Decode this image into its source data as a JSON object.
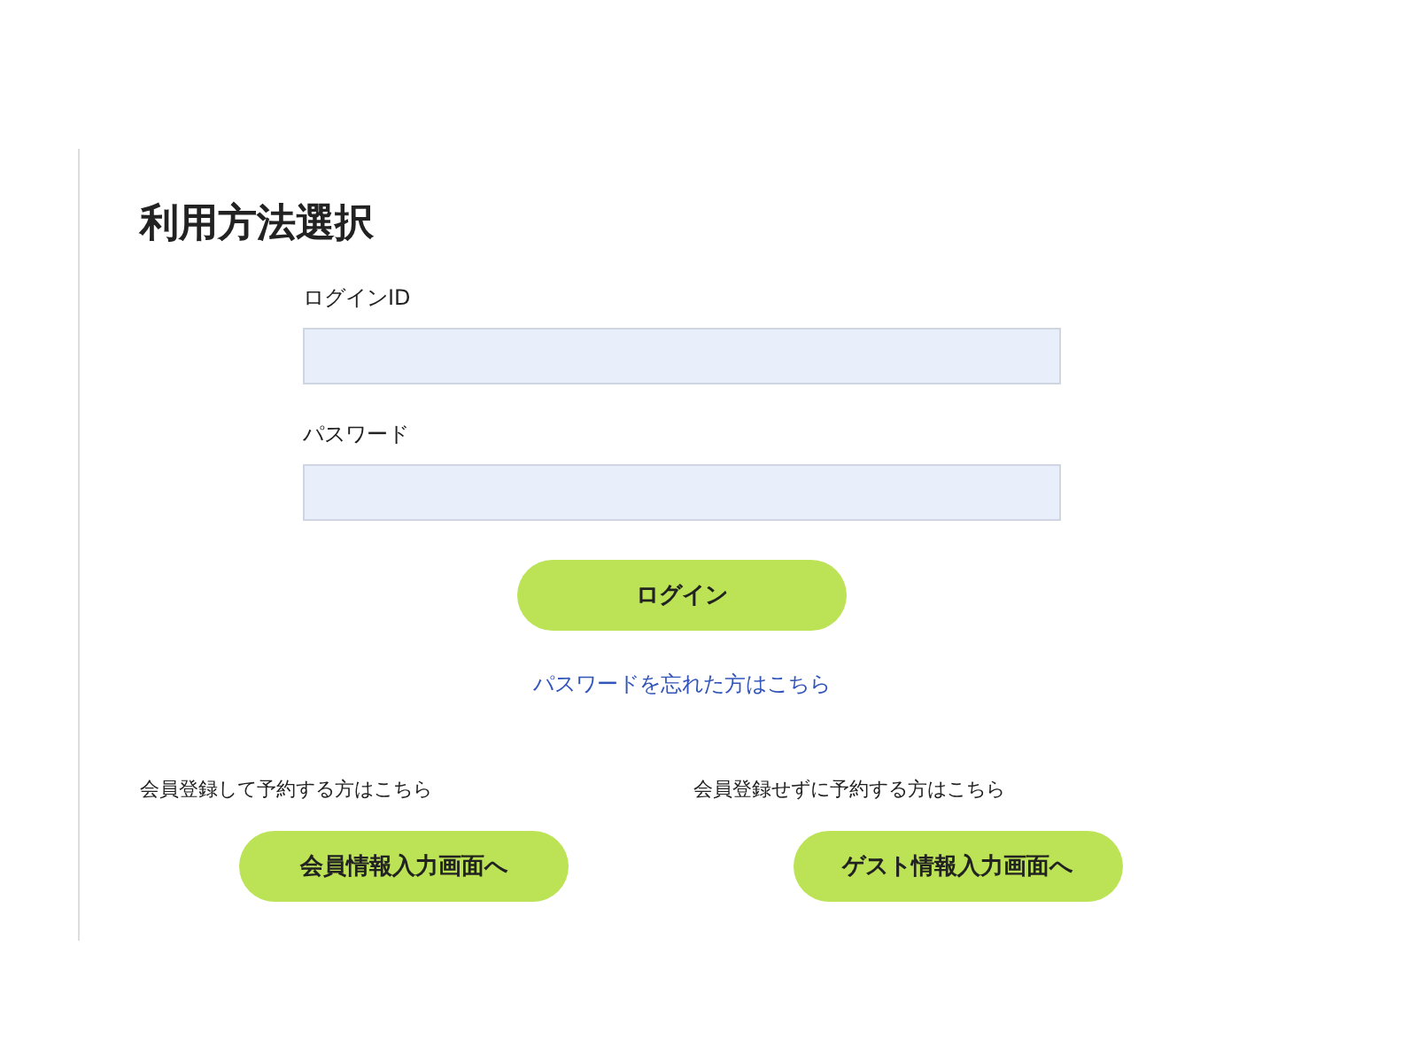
{
  "title": "利用方法選択",
  "fields": [
    {
      "label": "ログインID"
    },
    {
      "label": "パスワード"
    }
  ],
  "login_button": "ログイン",
  "forgot_link": "パスワードを忘れた方はこちら",
  "options": [
    {
      "caption": "会員登録して予約する方はこちら",
      "button": "会員情報入力画面へ"
    },
    {
      "caption": "会員登録せずに予約する方はこちら",
      "button": "ゲスト情報入力画面へ"
    }
  ]
}
